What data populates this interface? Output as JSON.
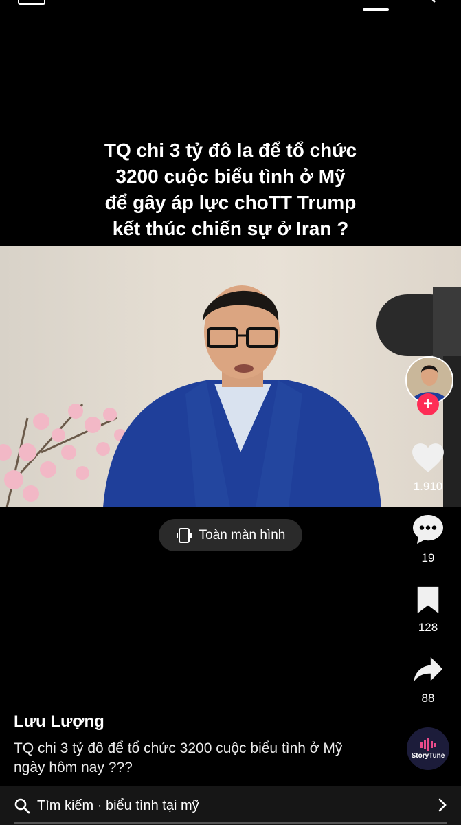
{
  "video": {
    "title_lines": [
      "TQ chi 3 tỷ đô la để tổ chức",
      "3200 cuộc biểu tình ở Mỹ",
      "để gây áp lực choTT Trump",
      "kết thúc chiến sự ở Iran ?"
    ],
    "fullscreen_label": "Toàn màn hình"
  },
  "sidebar": {
    "likes": "1.910",
    "comments": "19",
    "saves": "128",
    "shares": "88",
    "follow_symbol": "+"
  },
  "post": {
    "author": "Lưu Lượng",
    "caption": "TQ chi 3 tỷ đô để tổ chức 3200 cuộc biểu tình ở Mỹ ngày hôm nay ???"
  },
  "music": {
    "label": "StoryTune"
  },
  "search": {
    "text": "Tìm kiếm · biểu tình tại mỹ"
  },
  "colors": {
    "accent_red": "#fe2c55",
    "background": "#000000"
  },
  "icons": [
    "heart-icon",
    "comment-icon",
    "bookmark-icon",
    "share-icon",
    "search-icon",
    "chevron-right-icon",
    "fullscreen-icon"
  ]
}
